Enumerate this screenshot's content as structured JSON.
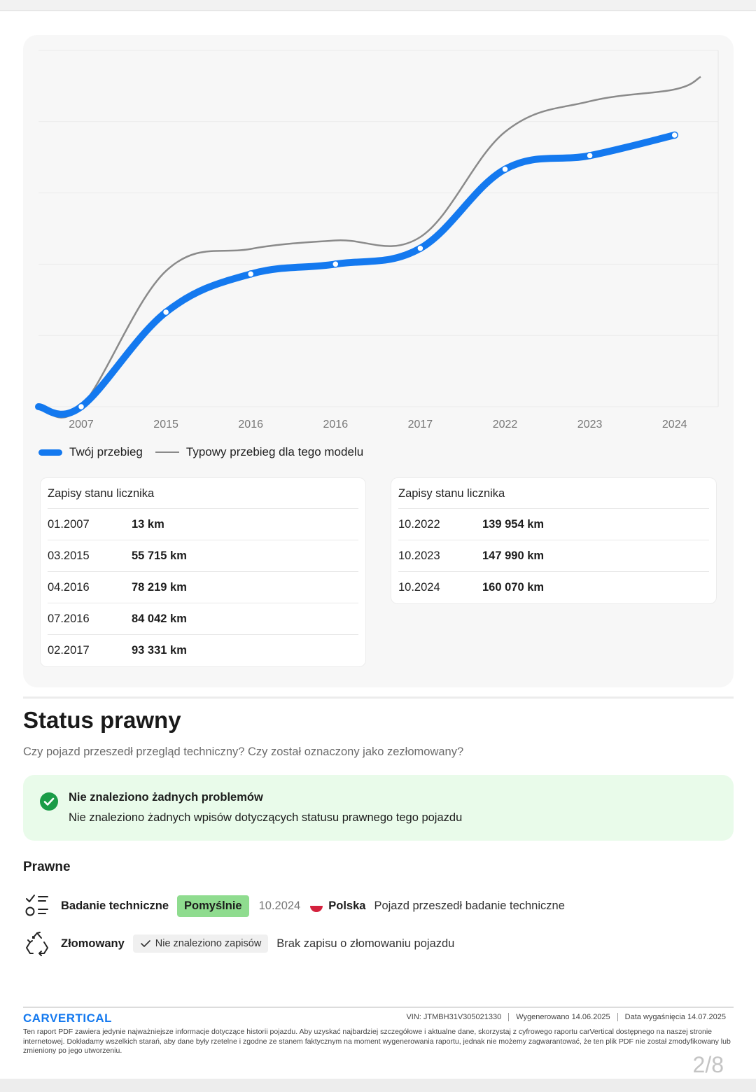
{
  "chart_data": {
    "type": "line",
    "categories": [
      "2007",
      "2015",
      "2016",
      "2016",
      "2017",
      "2022",
      "2023",
      "2024"
    ],
    "series": [
      {
        "name": "Twój przebieg",
        "values": [
          13,
          55715,
          78219,
          84042,
          93331,
          139954,
          147990,
          160070
        ],
        "color": "#1479ef"
      },
      {
        "name": "Typowy przebieg dla tego modelu",
        "values": [
          13,
          80000,
          93000,
          98000,
          100000,
          162000,
          180000,
          187000
        ],
        "color": "#8a8a8a"
      }
    ],
    "ylim": [
      0,
      210000
    ],
    "grid": true,
    "legend_placement": "bottom-left"
  },
  "legend": {
    "yours": "Twój przebieg",
    "typical": "Typowy przebieg dla tego modelu"
  },
  "tables": [
    {
      "header": "Zapisy stanu licznika",
      "rows": [
        {
          "date": "01.2007",
          "value": "13 km"
        },
        {
          "date": "03.2015",
          "value": "55 715 km"
        },
        {
          "date": "04.2016",
          "value": "78 219 km"
        },
        {
          "date": "07.2016",
          "value": "84 042 km"
        },
        {
          "date": "02.2017",
          "value": "93 331 km"
        }
      ]
    },
    {
      "header": "Zapisy stanu licznika",
      "rows": [
        {
          "date": "10.2022",
          "value": "139 954 km"
        },
        {
          "date": "10.2023",
          "value": "147 990 km"
        },
        {
          "date": "10.2024",
          "value": "160 070 km"
        }
      ]
    }
  ],
  "status": {
    "title": "Status prawny",
    "subtitle": "Czy pojazd przeszedł przegląd techniczny? Czy został oznaczony jako zezłomowany?",
    "ok_title": "Nie znaleziono żadnych problemów",
    "ok_text": "Nie znaleziono żadnych wpisów dotyczących statusu prawnego tego pojazdu",
    "section": "Prawne",
    "inspection": {
      "label": "Badanie techniczne",
      "badge": "Pomyślnie",
      "date": "10.2024",
      "country": "Polska",
      "description": "Pojazd przeszedł badanie techniczne",
      "icon": "checklist-icon"
    },
    "scrapped": {
      "label": "Złomowany",
      "badge": "Nie znaleziono zapisów",
      "description": "Brak zapisu o złomowaniu pojazdu",
      "icon": "recycle-icon"
    }
  },
  "footer": {
    "logo": "CARVERTICAL",
    "vin": "VIN: JTMBH31V305021330",
    "generated": "Wygenerowano 14.06.2025",
    "expiry": "Data wygaśnięcia 14.07.2025",
    "disclaimer": "Ten raport PDF zawiera jedynie najważniejsze informacje dotyczące historii pojazdu. Aby uzyskać najbardziej szczegółowe i aktualne dane, skorzystaj z cyfrowego raportu carVertical dostępnego na naszej stronie internetowej. Dokładamy wszelkich starań, aby dane były rzetelne i zgodne ze stanem faktycznym na moment wygenerowania raportu, jednak nie możemy zagwarantować, że ten plik PDF nie został zmodyfikowany lub zmieniony po jego utworzeniu.",
    "page": "2/8"
  },
  "colors": {
    "accent": "#1479ef",
    "typical_line": "#8a8a8a",
    "success_bg": "#e9fbea",
    "success_icon": "#1a9c47",
    "badge_green": "#8fdc8f"
  }
}
